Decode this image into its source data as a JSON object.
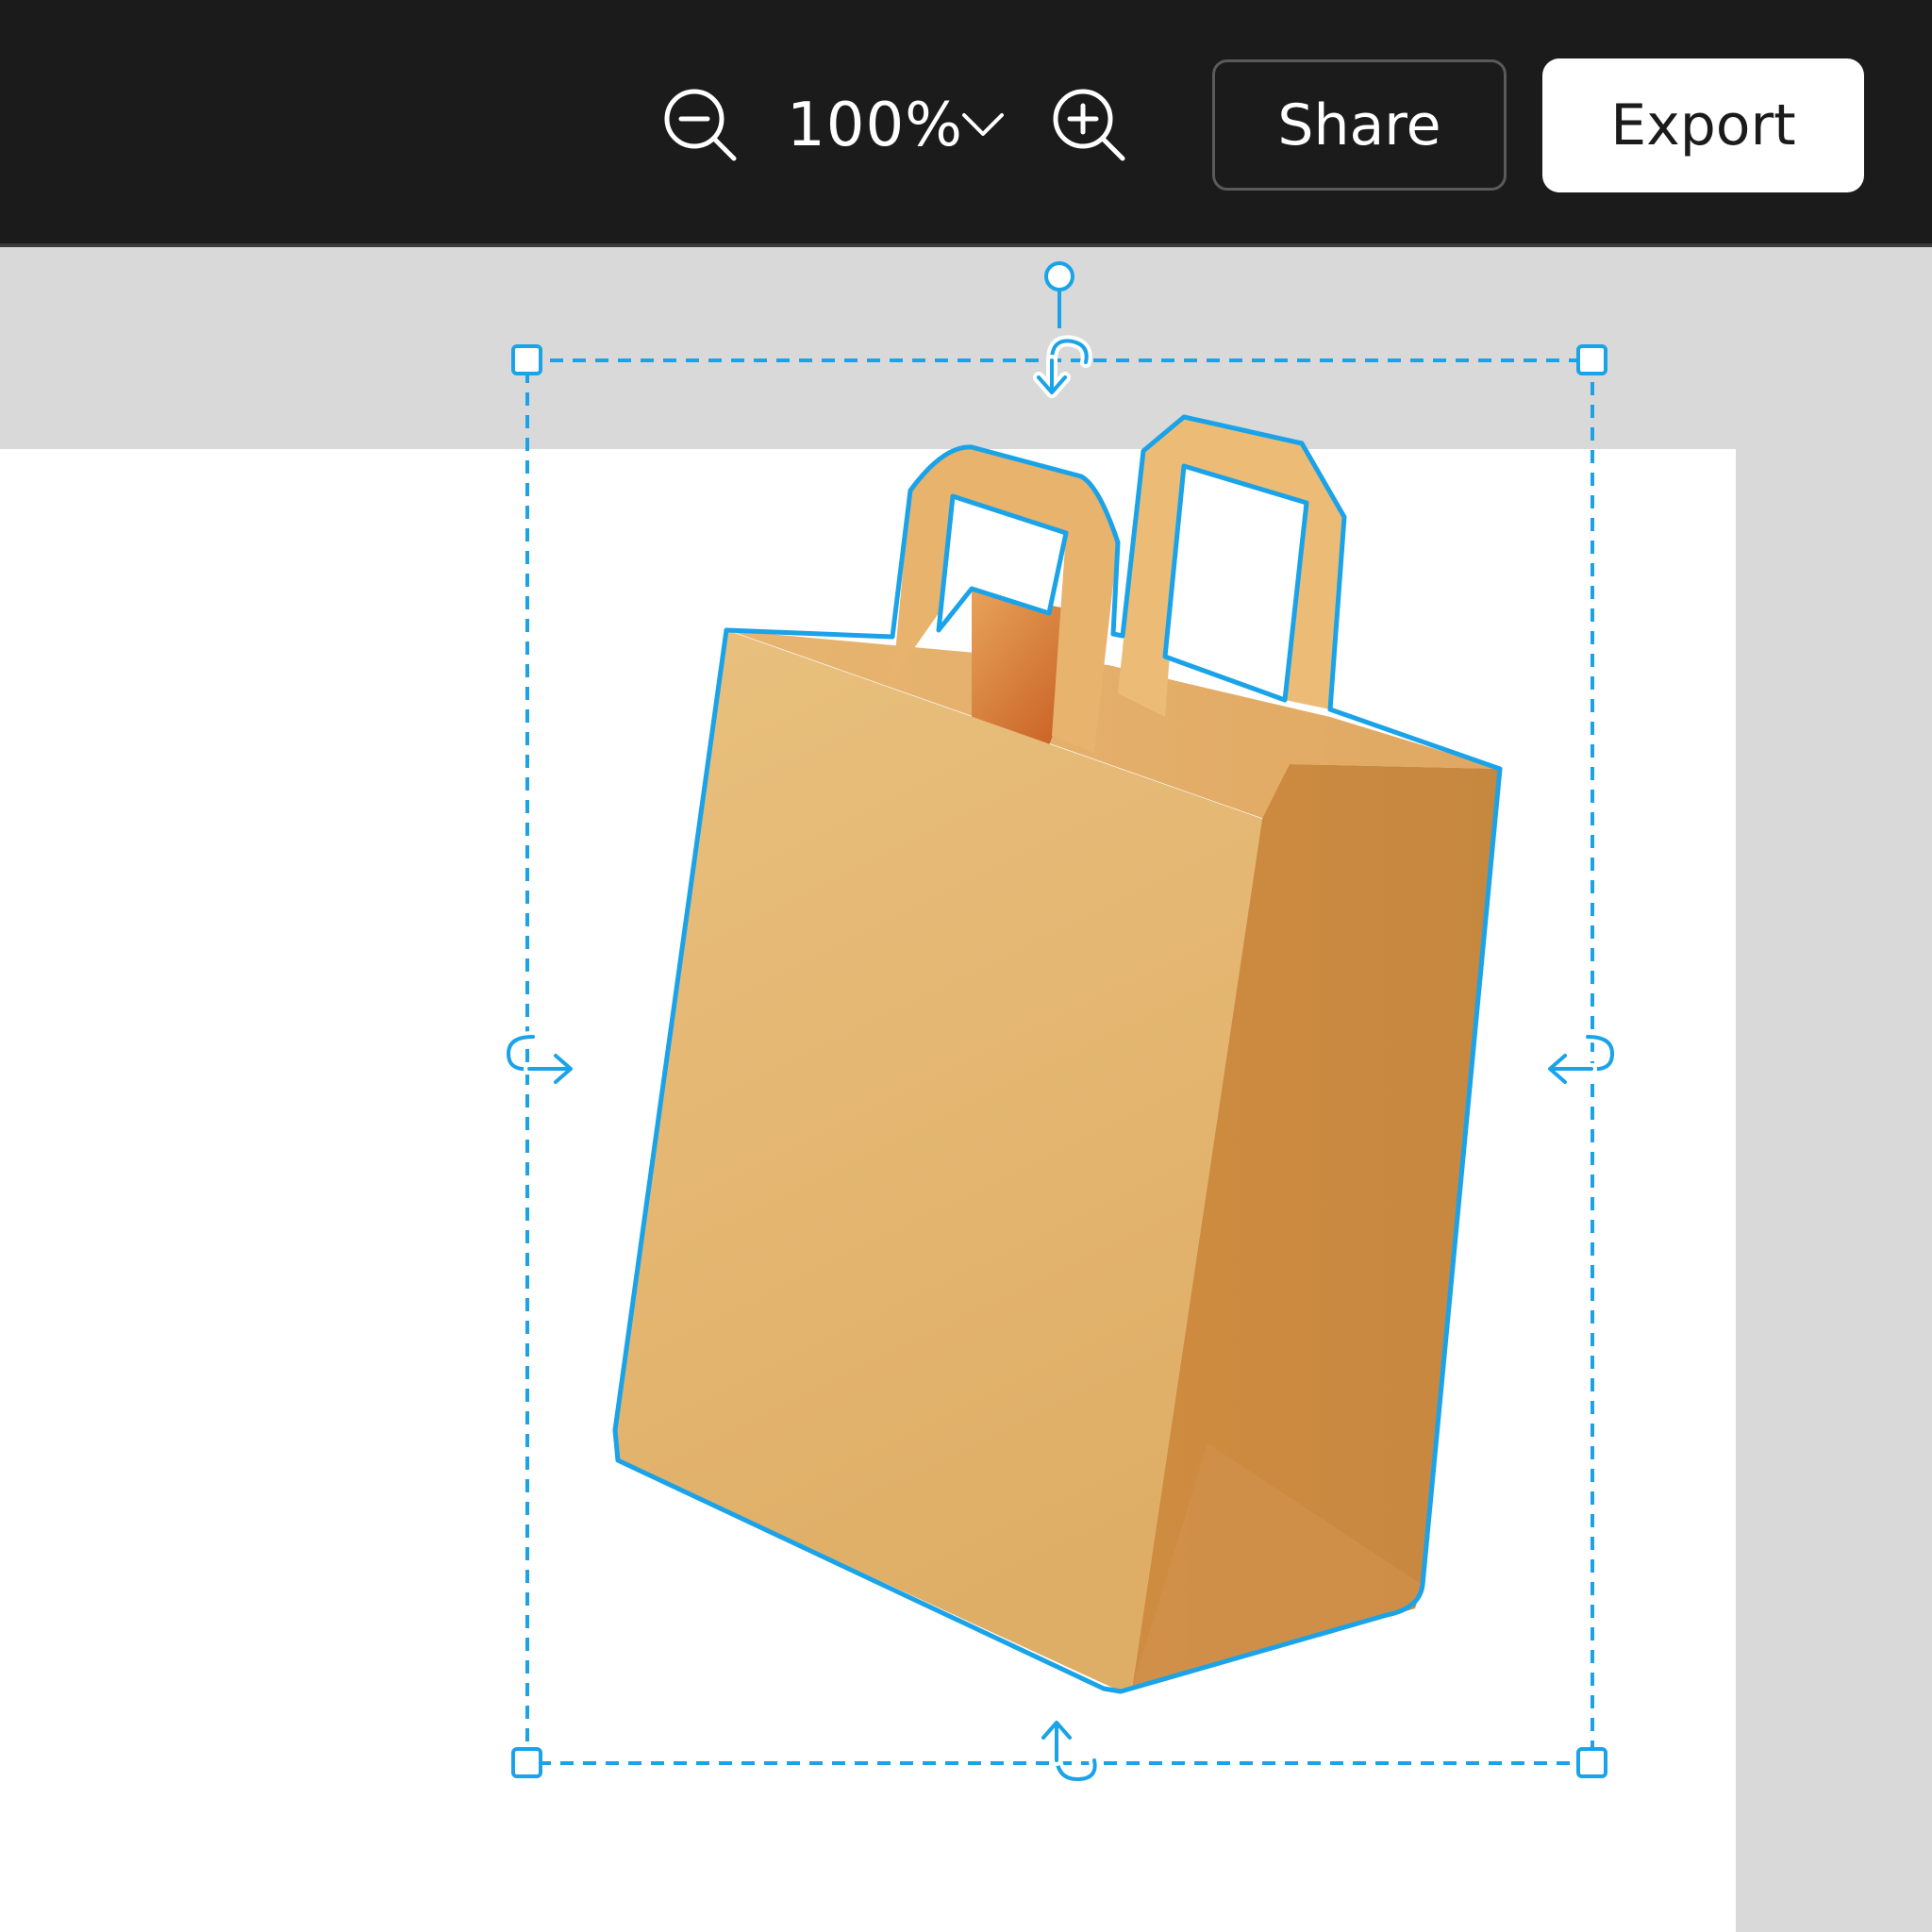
{
  "toolbar": {
    "zoom_out_icon": "zoom-out-icon",
    "zoom_value": "100%",
    "zoom_dropdown_icon": "chevron-down-icon",
    "zoom_in_icon": "zoom-in-icon",
    "share_label": "Share",
    "export_label": "Export"
  },
  "canvas": {
    "selected_object": "shopping-bag-image",
    "selection_color": "#1aa3e8",
    "background_color": "#d9d9d9",
    "artboard_color": "#ffffff"
  },
  "colors": {
    "toolbar_bg": "#1b1b1b",
    "bag_front": "#e3b673",
    "bag_side": "#c98a42",
    "bag_inside": "#d4813a"
  }
}
